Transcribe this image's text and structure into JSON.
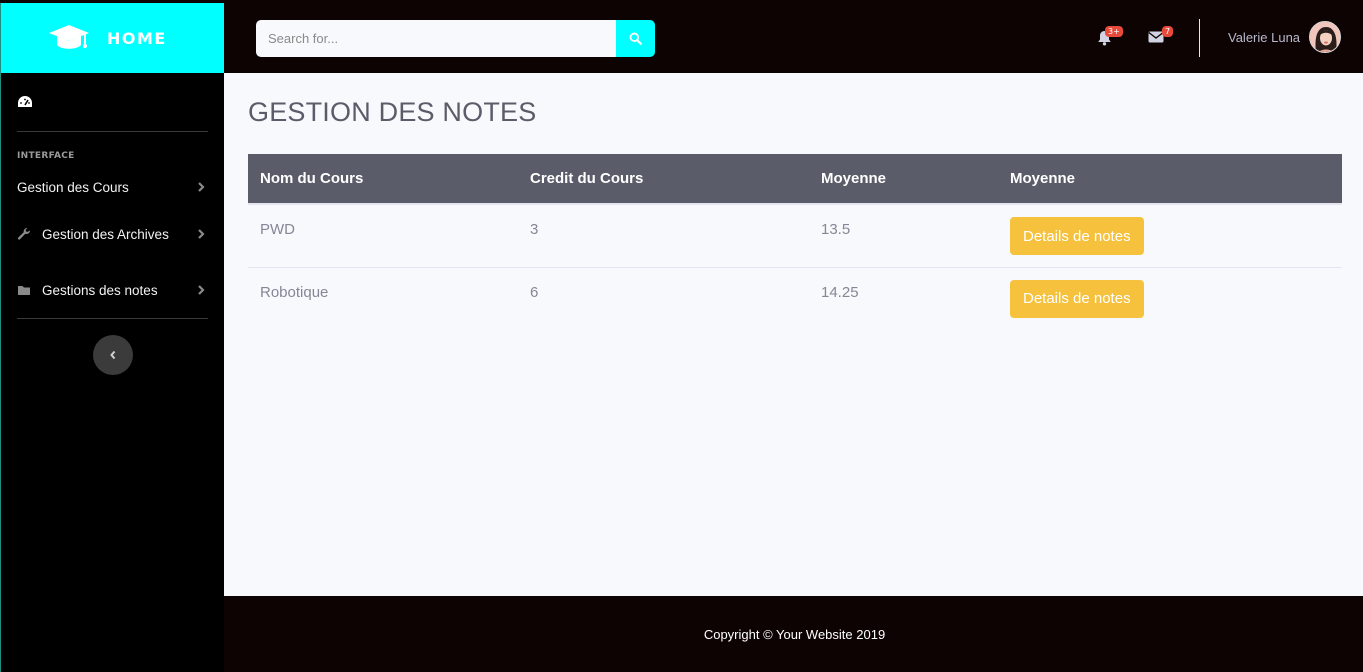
{
  "brand": {
    "title": "HOME",
    "accent": "#00ffff"
  },
  "sidebar": {
    "heading": "INTERFACE",
    "items": [
      {
        "label": "Gestion des Cours",
        "icon": "none"
      },
      {
        "label": "Gestion des Archives",
        "icon": "wrench-icon"
      },
      {
        "label": "Gestions des notes",
        "icon": "folder-icon"
      }
    ]
  },
  "topbar": {
    "search_placeholder": "Search for...",
    "alerts_badge": "3+",
    "messages_badge": "7",
    "user_name": "Valerie Luna"
  },
  "main": {
    "title": "GESTION DES NOTES",
    "table": {
      "headers": [
        "Nom du Cours",
        "Credit du Cours",
        "Moyenne",
        "Moyenne"
      ],
      "rows": [
        {
          "course": "PWD",
          "credit": "3",
          "average": "13.5",
          "action": "Details de notes"
        },
        {
          "course": "Robotique",
          "credit": "6",
          "average": "14.25",
          "action": "Details de notes"
        }
      ]
    }
  },
  "footer": {
    "copyright": "Copyright © Your Website 2019"
  },
  "colors": {
    "button_warning": "#f6c23e",
    "table_header": "#5a5c69",
    "topbar": "#0e0303"
  }
}
